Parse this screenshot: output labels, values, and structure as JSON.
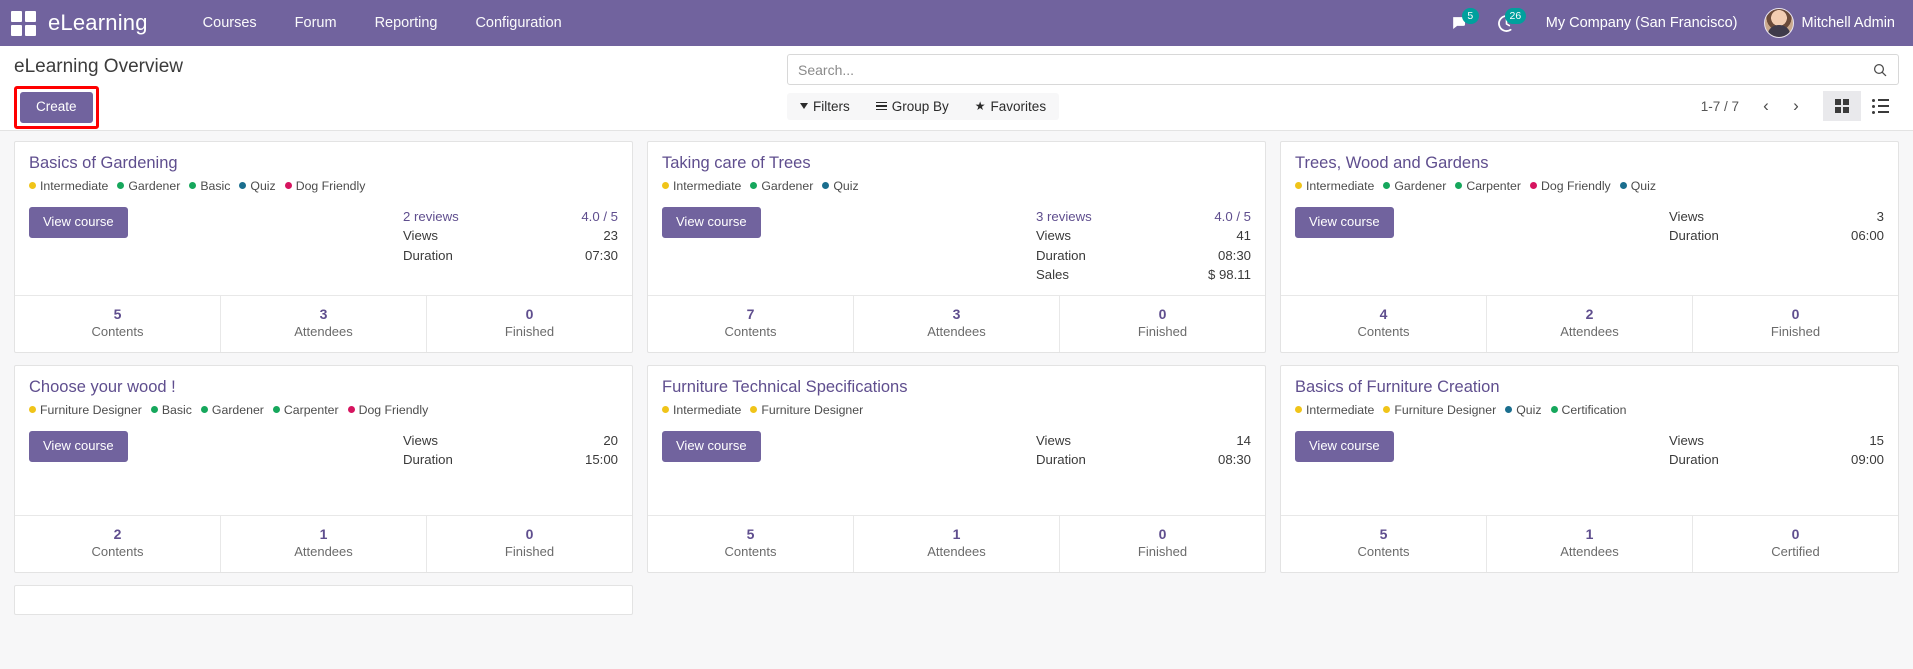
{
  "navbar": {
    "apps_icon": "apps-grid-icon",
    "brand": "eLearning",
    "menu": [
      {
        "label": "Courses"
      },
      {
        "label": "Forum"
      },
      {
        "label": "Reporting"
      },
      {
        "label": "Configuration"
      }
    ],
    "messages_icon": "messages-icon",
    "messages_count": "5",
    "activities_icon": "clock-icon",
    "activities_count": "26",
    "company": "My Company (San Francisco)",
    "user": "Mitchell Admin",
    "colors": {
      "bg": "#71639e",
      "badge": "#00a09d"
    }
  },
  "control_panel": {
    "title": "eLearning Overview",
    "create_label": "Create",
    "create_highlight_color": "#ff0000",
    "search": {
      "placeholder": "Search...",
      "value": "",
      "icon": "search-icon"
    },
    "filters": [
      {
        "label": "Filters",
        "icon": "filter-caret-icon"
      },
      {
        "label": "Group By",
        "icon": "group-by-icon"
      },
      {
        "label": "Favorites",
        "icon": "star-icon"
      }
    ],
    "pager": {
      "range": "1-7 / 7",
      "prev_icon": "chevron-left-icon",
      "next_icon": "chevron-right-icon"
    },
    "views": [
      {
        "name": "kanban",
        "icon": "kanban-view-icon",
        "active": true
      },
      {
        "name": "list",
        "icon": "list-view-icon",
        "active": false
      }
    ]
  },
  "courses": [
    {
      "title": "Basics of Gardening",
      "tags": [
        {
          "label": "Intermediate",
          "color": "#f0c419"
        },
        {
          "label": "Gardener",
          "color": "#16a75c"
        },
        {
          "label": "Basic",
          "color": "#16a75c"
        },
        {
          "label": "Quiz",
          "color": "#1a6e8e"
        },
        {
          "label": "Dog Friendly",
          "color": "#d6145f"
        }
      ],
      "action_label": "View course",
      "stats": [
        {
          "key": "2 reviews",
          "value": "4.0 / 5",
          "is_review": true
        },
        {
          "key": "Views",
          "value": "23"
        },
        {
          "key": "Duration",
          "value": "07:30"
        }
      ],
      "footer": [
        {
          "num": "5",
          "label": "Contents"
        },
        {
          "num": "3",
          "label": "Attendees"
        },
        {
          "num": "0",
          "label": "Finished"
        }
      ]
    },
    {
      "title": "Taking care of Trees",
      "tags": [
        {
          "label": "Intermediate",
          "color": "#f0c419"
        },
        {
          "label": "Gardener",
          "color": "#16a75c"
        },
        {
          "label": "Quiz",
          "color": "#1a6e8e"
        }
      ],
      "action_label": "View course",
      "stats": [
        {
          "key": "3 reviews",
          "value": "4.0 / 5",
          "is_review": true
        },
        {
          "key": "Views",
          "value": "41"
        },
        {
          "key": "Duration",
          "value": "08:30"
        },
        {
          "key": "Sales",
          "value": "$ 98.11"
        }
      ],
      "footer": [
        {
          "num": "7",
          "label": "Contents"
        },
        {
          "num": "3",
          "label": "Attendees"
        },
        {
          "num": "0",
          "label": "Finished"
        }
      ]
    },
    {
      "title": "Trees, Wood and Gardens",
      "tags": [
        {
          "label": "Intermediate",
          "color": "#f0c419"
        },
        {
          "label": "Gardener",
          "color": "#16a75c"
        },
        {
          "label": "Carpenter",
          "color": "#16a75c"
        },
        {
          "label": "Dog Friendly",
          "color": "#d6145f"
        },
        {
          "label": "Quiz",
          "color": "#1a6e8e"
        }
      ],
      "action_label": "View course",
      "stats": [
        {
          "key": "Views",
          "value": "3"
        },
        {
          "key": "Duration",
          "value": "06:00"
        }
      ],
      "footer": [
        {
          "num": "4",
          "label": "Contents"
        },
        {
          "num": "2",
          "label": "Attendees"
        },
        {
          "num": "0",
          "label": "Finished"
        }
      ]
    },
    {
      "title": "Choose your wood !",
      "tags": [
        {
          "label": "Furniture Designer",
          "color": "#f0c419"
        },
        {
          "label": "Basic",
          "color": "#16a75c"
        },
        {
          "label": "Gardener",
          "color": "#16a75c"
        },
        {
          "label": "Carpenter",
          "color": "#16a75c"
        },
        {
          "label": "Dog Friendly",
          "color": "#d6145f"
        }
      ],
      "action_label": "View course",
      "stats": [
        {
          "key": "Views",
          "value": "20"
        },
        {
          "key": "Duration",
          "value": "15:00"
        }
      ],
      "footer": [
        {
          "num": "2",
          "label": "Contents"
        },
        {
          "num": "1",
          "label": "Attendees"
        },
        {
          "num": "0",
          "label": "Finished"
        }
      ]
    },
    {
      "title": "Furniture Technical Specifications",
      "tags": [
        {
          "label": "Intermediate",
          "color": "#f0c419"
        },
        {
          "label": "Furniture Designer",
          "color": "#f0c419"
        }
      ],
      "action_label": "View course",
      "stats": [
        {
          "key": "Views",
          "value": "14"
        },
        {
          "key": "Duration",
          "value": "08:30"
        }
      ],
      "footer": [
        {
          "num": "5",
          "label": "Contents"
        },
        {
          "num": "1",
          "label": "Attendees"
        },
        {
          "num": "0",
          "label": "Finished"
        }
      ]
    },
    {
      "title": "Basics of Furniture Creation",
      "tags": [
        {
          "label": "Intermediate",
          "color": "#f0c419"
        },
        {
          "label": "Furniture Designer",
          "color": "#f0c419"
        },
        {
          "label": "Quiz",
          "color": "#1a6e8e"
        },
        {
          "label": "Certification",
          "color": "#16a75c"
        }
      ],
      "action_label": "View course",
      "stats": [
        {
          "key": "Views",
          "value": "15"
        },
        {
          "key": "Duration",
          "value": "09:00"
        }
      ],
      "footer": [
        {
          "num": "5",
          "label": "Contents"
        },
        {
          "num": "1",
          "label": "Attendees"
        },
        {
          "num": "0",
          "label": "Certified"
        }
      ]
    }
  ]
}
